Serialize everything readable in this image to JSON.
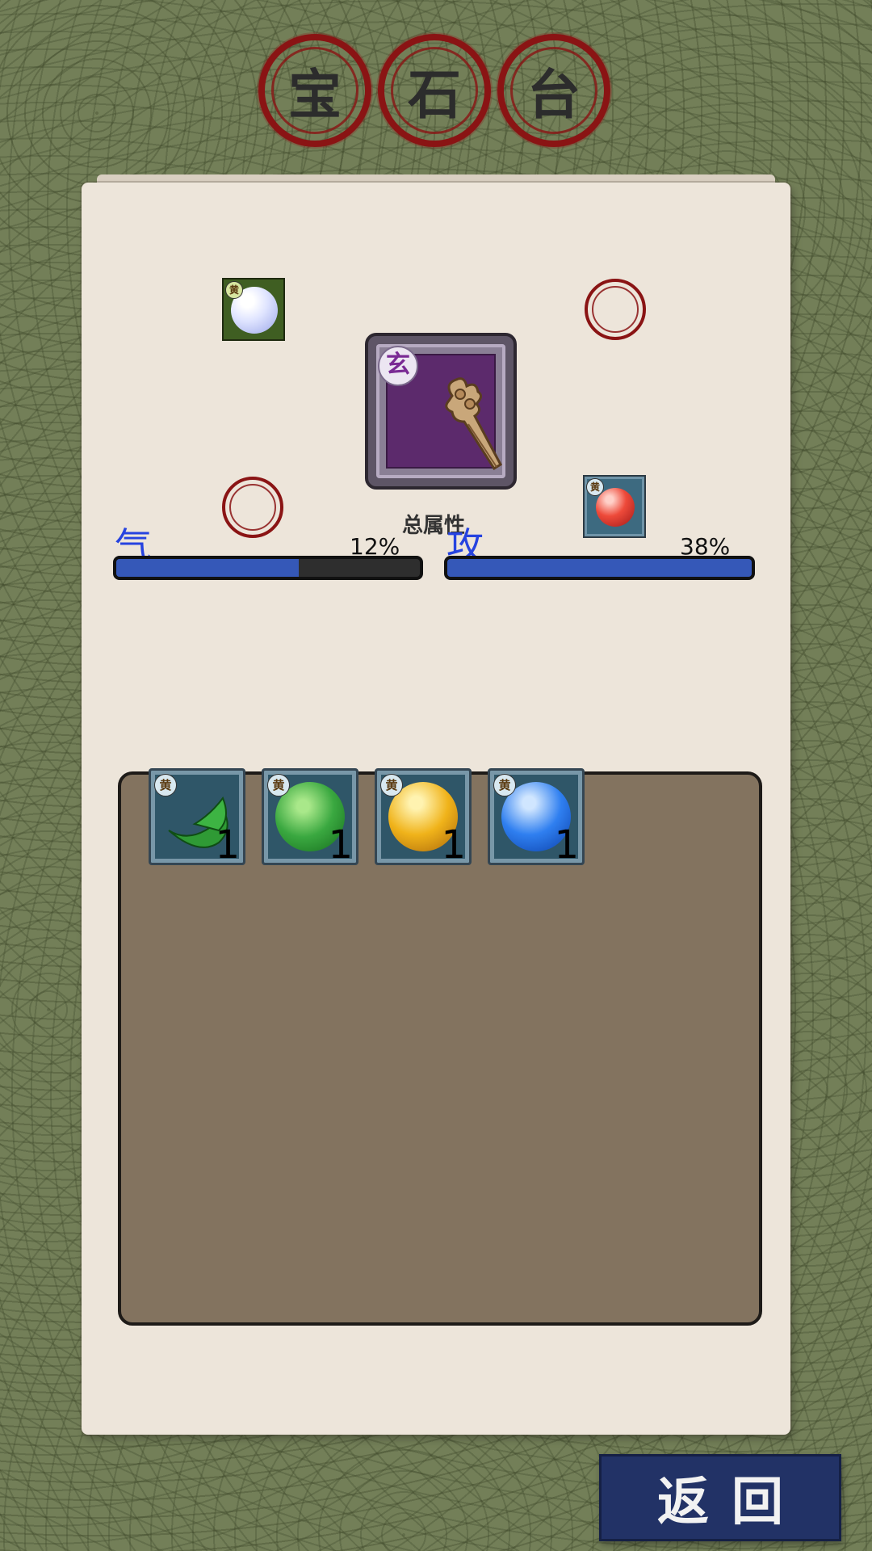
{
  "title": {
    "chars": [
      "宝",
      "石",
      "台"
    ]
  },
  "equipped_item": {
    "tier": "玄",
    "icon": "dagger-icon"
  },
  "gem_slots": [
    {
      "state": "filled",
      "tier": "黄",
      "icon": "white-gem-icon"
    },
    {
      "state": "empty",
      "icon": "empty-socket-ring"
    },
    {
      "state": "empty",
      "icon": "empty-socket-ring"
    },
    {
      "state": "filled",
      "tier": "黄",
      "icon": "red-gem-icon"
    }
  ],
  "total_label": "总属性",
  "stats": [
    {
      "name": "气",
      "percent_label": "12%",
      "fill": 0.6
    },
    {
      "name": "攻",
      "percent_label": "38%",
      "fill": 1.0
    }
  ],
  "inventory": [
    {
      "tier": "黄",
      "count": "1",
      "icon": "green-leaf-gem-icon"
    },
    {
      "tier": "黄",
      "count": "1",
      "icon": "green-gem-icon"
    },
    {
      "tier": "黄",
      "count": "1",
      "icon": "yellow-gem-icon"
    },
    {
      "tier": "黄",
      "count": "1",
      "icon": "blue-gem-icon"
    }
  ],
  "return_button": "返回",
  "colors": {
    "background": "#737f58",
    "paper": "#ede5da",
    "seal": "#8a1414",
    "stat_text": "#2643e0",
    "bar_fill": "#3558b8",
    "button": "#223266"
  }
}
